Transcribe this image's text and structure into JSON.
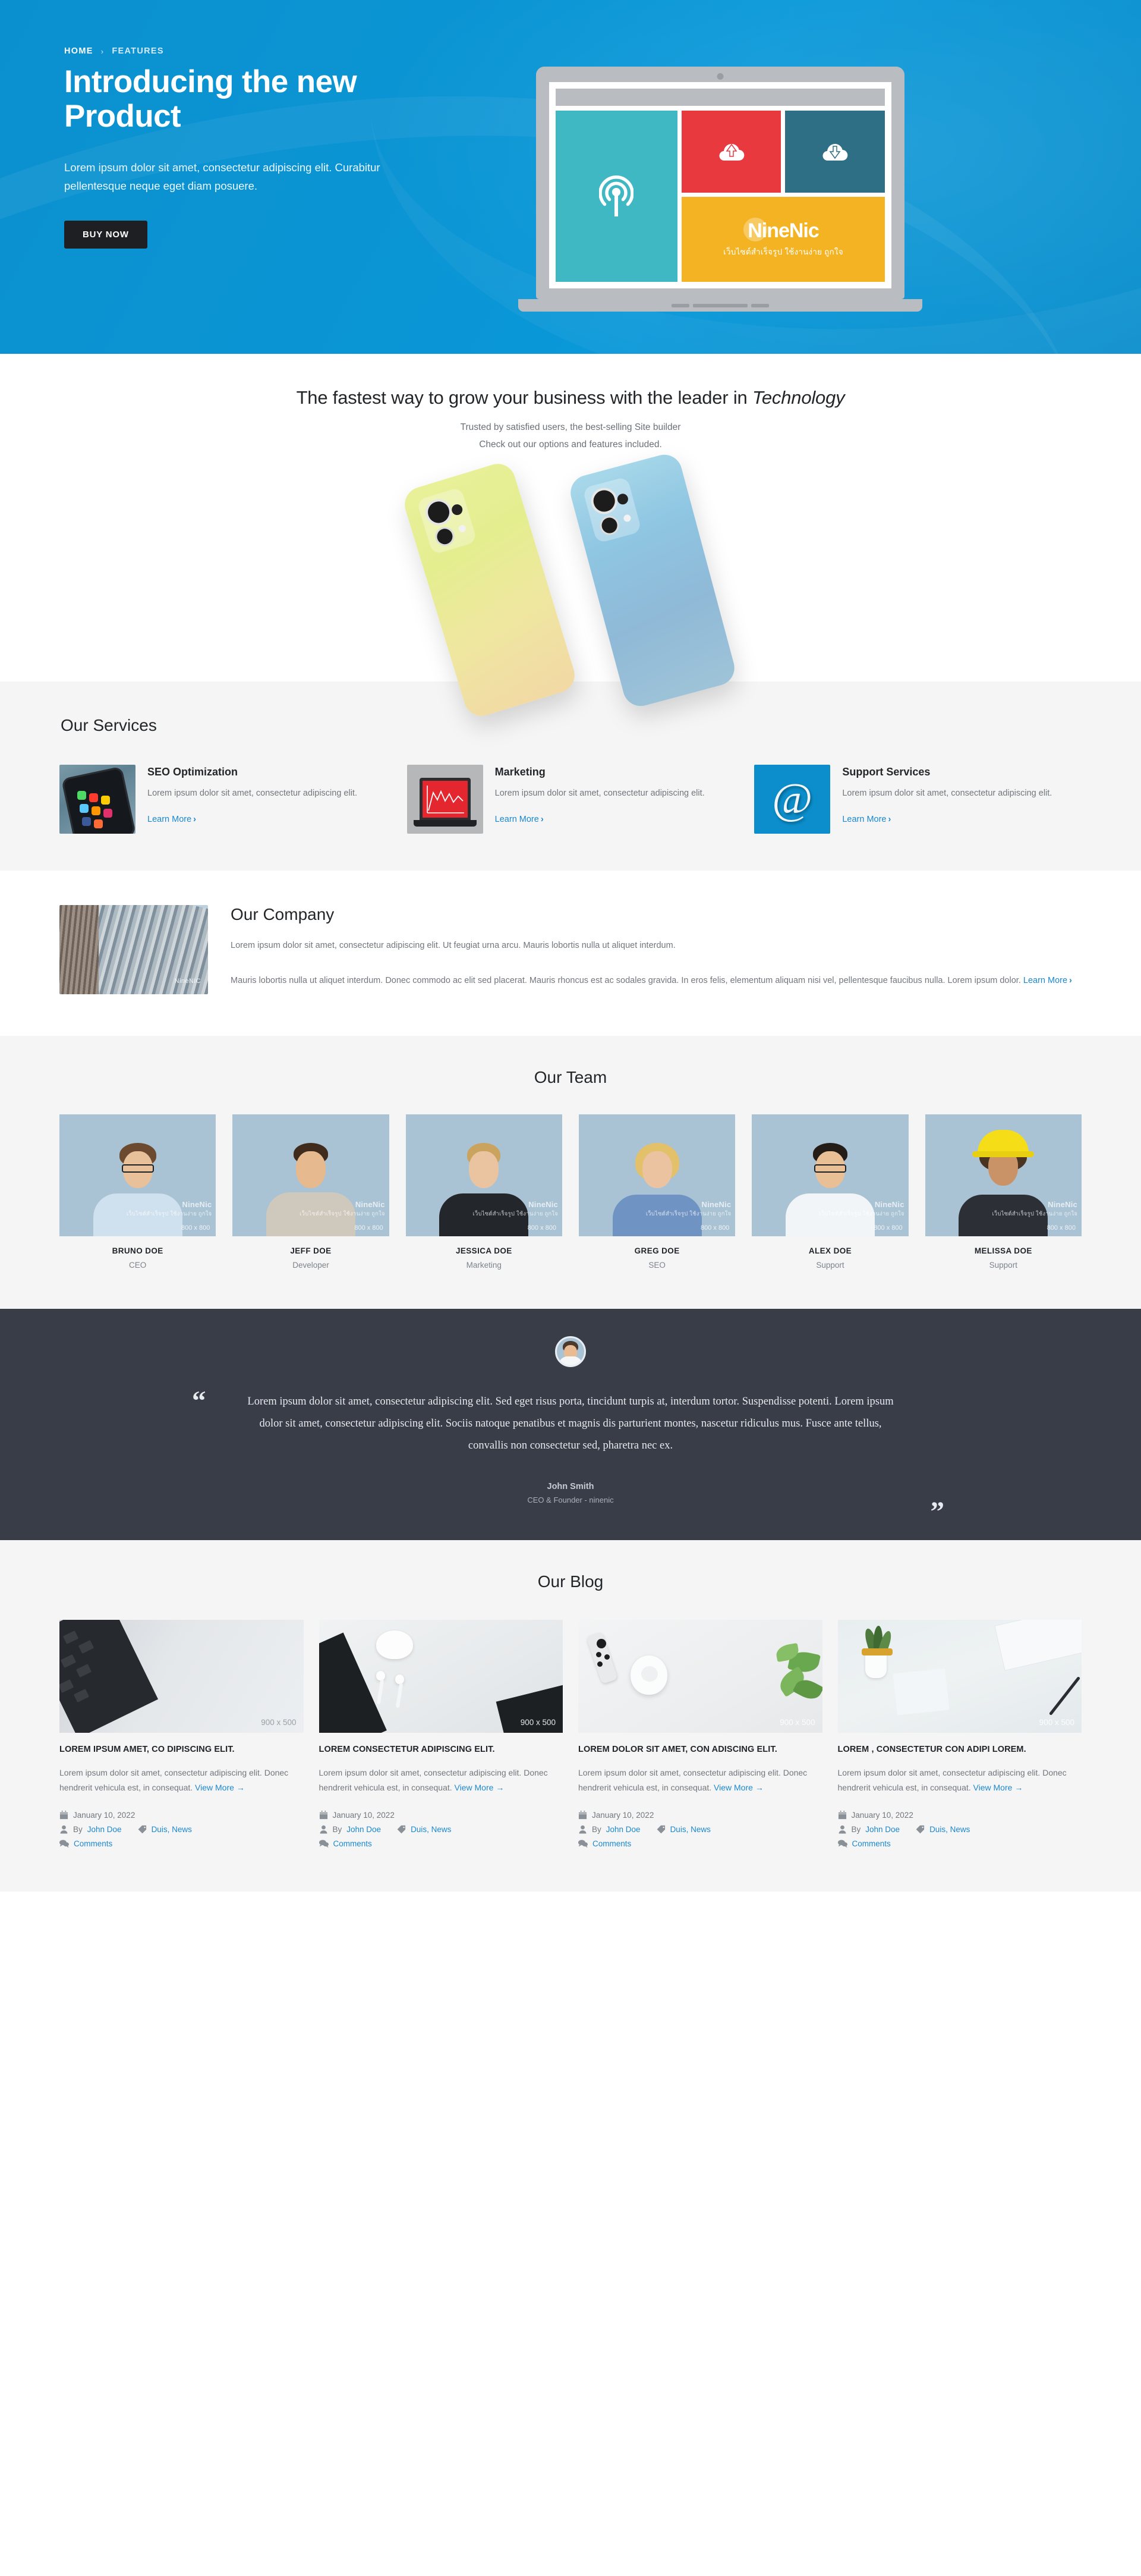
{
  "hero": {
    "breadcrumb": {
      "home": "HOME",
      "separator": "›",
      "current": "FEATURES"
    },
    "title_line1": "Introducing the new",
    "title_line2": "Product",
    "lead": "Lorem ipsum dolor sit amet, consectetur adipiscing elit. Curabitur pellentesque neque eget diam posuere.",
    "cta": "BUY NOW",
    "laptop": {
      "logo": "NineNic",
      "tagline": "เว็บไซต์สำเร็จรูป ใช้งานง่าย ถูกใจ"
    },
    "accent_color": "#0b94d3",
    "cta_color": "#1d1f22"
  },
  "tech": {
    "heading_plain": "The fastest way to grow your business with the leader in ",
    "heading_em": "Technology",
    "sub1": "Trusted by satisfied users, the best-selling Site builder",
    "sub2": "Check out our options and features included."
  },
  "services": {
    "heading": "Our Services",
    "items": [
      {
        "title": "SEO Optimization",
        "desc": "Lorem ipsum dolor sit amet, consectetur adipiscing elit.",
        "link": "Learn More",
        "chev": "›"
      },
      {
        "title": "Marketing",
        "desc": "Lorem ipsum dolor sit amet, consectetur adipiscing elit.",
        "link": "Learn More",
        "chev": "›"
      },
      {
        "title": "Support Services",
        "desc": "Lorem ipsum dolor sit amet, consectetur adipiscing elit.",
        "link": "Learn More",
        "chev": "›"
      }
    ]
  },
  "company": {
    "heading": "Our Company",
    "image_watermark": "NineNIC",
    "para1": "Lorem ipsum dolor sit amet, consectetur adipiscing elit. Ut feugiat urna arcu. Mauris lobortis nulla ut aliquet interdum.",
    "para2": "Mauris lobortis nulla ut aliquet interdum. Donec commodo ac elit sed placerat. Mauris rhoncus est ac sodales gravida. In eros felis, elementum aliquam nisi vel, pellentesque faucibus nulla. Lorem ipsum dolor. ",
    "link": "Learn More",
    "chev": "›"
  },
  "team": {
    "heading": "Our Team",
    "placeholder_dim": "800 x 800",
    "watermark_logo": "NineNic",
    "watermark_tagline": "เว็บไซต์สำเร็จรูป ใช้งานง่าย ถูกใจ",
    "members": [
      {
        "name": "BRUNO DOE",
        "role": "CEO"
      },
      {
        "name": "JEFF DOE",
        "role": "Developer"
      },
      {
        "name": "JESSICA DOE",
        "role": "Marketing"
      },
      {
        "name": "GREG DOE",
        "role": "SEO"
      },
      {
        "name": "ALEX DOE",
        "role": "Support"
      },
      {
        "name": "MELISSA DOE",
        "role": "Support"
      }
    ]
  },
  "testimonial": {
    "quote_open": "“",
    "quote_close": "”",
    "text": "Lorem ipsum dolor sit amet, consectetur adipiscing elit. Sed eget risus porta, tincidunt turpis at, interdum tortor. Suspendisse potenti. Lorem ipsum dolor sit amet, consectetur adipiscing elit. Sociis natoque penatibus et magnis dis parturient montes, nascetur ridiculus mus. Fusce ante tellus, convallis non consectetur sed, pharetra nec ex.",
    "name": "John Smith",
    "role": "CEO & Founder - ninenic",
    "bg_color": "#383d47"
  },
  "blog": {
    "heading": "Our Blog",
    "placeholder_dim": "900 x 500",
    "posts": [
      {
        "title": "LOREM IPSUM AMET, CO DIPISCING ELIT.",
        "excerpt": "Lorem ipsum dolor sit amet, consectetur adipiscing elit. Donec hendrerit vehicula est, in consequat. ",
        "more": "View More",
        "arrow": "→",
        "date": "January 10, 2022",
        "by_label": "By",
        "author": "John Doe",
        "tags": "Duis, News",
        "comments": "Comments"
      },
      {
        "title": "LOREM CONSECTETUR ADIPISCING ELIT.",
        "excerpt": "Lorem ipsum dolor sit amet, consectetur adipiscing elit. Donec hendrerit vehicula est, in consequat. ",
        "more": "View More",
        "arrow": "→",
        "date": "January 10, 2022",
        "by_label": "By",
        "author": "John Doe",
        "tags": "Duis, News",
        "comments": "Comments"
      },
      {
        "title": "LOREM DOLOR SIT AMET, CON ADISCING ELIT.",
        "excerpt": "Lorem ipsum dolor sit amet, consectetur adipiscing elit. Donec hendrerit vehicula est, in consequat. ",
        "more": "View More",
        "arrow": "→",
        "date": "January 10, 2022",
        "by_label": "By",
        "author": "John Doe",
        "tags": "Duis, News",
        "comments": "Comments"
      },
      {
        "title": "LOREM , CONSECTETUR CON ADIPI LOREM.",
        "excerpt": "Lorem ipsum dolor sit amet, consectetur adipiscing elit. Donec hendrerit vehicula est, in consequat. ",
        "more": "View More",
        "arrow": "→",
        "date": "January 10, 2022",
        "by_label": "By",
        "author": "John Doe",
        "tags": "Duis, News",
        "comments": "Comments"
      }
    ]
  },
  "colors": {
    "link": "#1a88d0",
    "heading": "#232629",
    "muted": "#72777d",
    "light_bg": "#f5f5f5"
  }
}
